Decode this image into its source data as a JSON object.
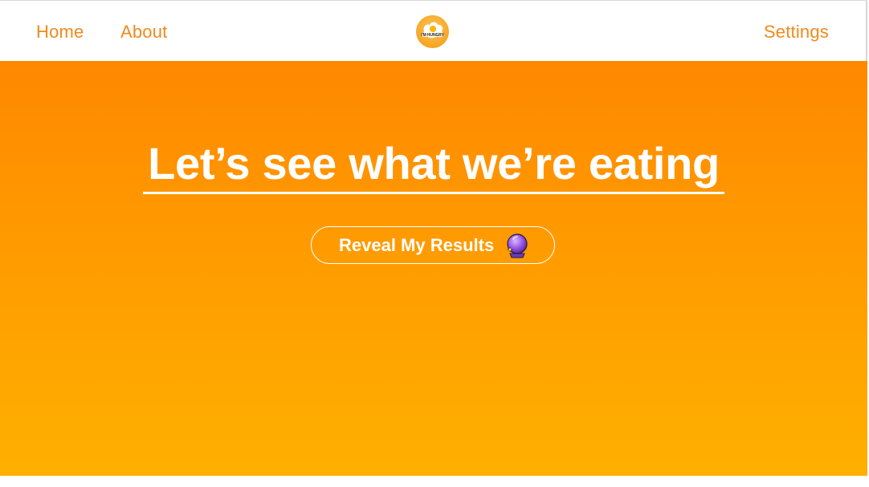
{
  "nav": {
    "home_label": "Home",
    "about_label": "About",
    "settings_label": "Settings",
    "logo_text": "I'M HUNGRY",
    "link_color": "#f08a1c"
  },
  "hero": {
    "title": "Let’s see what we’re eating",
    "button_label": "Reveal My Results",
    "button_icon": "crystal-ball-icon",
    "gradient_top": "#ff8800",
    "gradient_bottom": "#ffb000"
  }
}
